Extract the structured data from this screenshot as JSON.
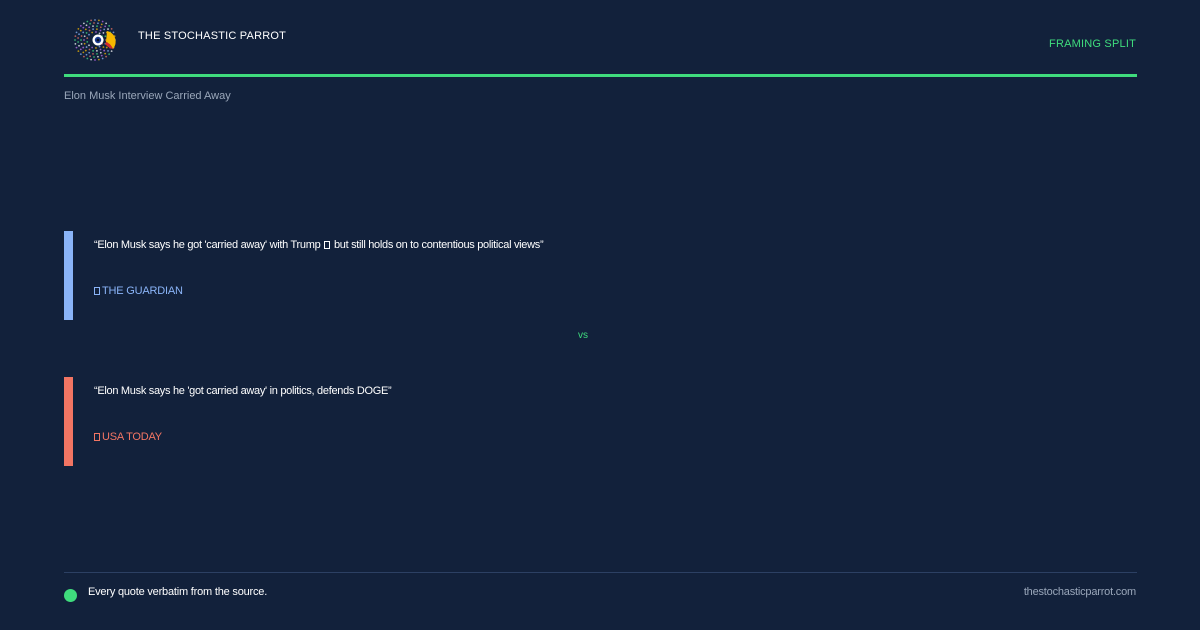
{
  "header": {
    "brand_name": "THE STOCHASTIC PARROT",
    "mode_label": "FRAMING SPLIT",
    "logo_icon": "parrot-logo-icon"
  },
  "story": {
    "title": "Elon Musk Interview Carried Away"
  },
  "quotes": [
    {
      "text_part1": "“Elon Musk says he got 'carried away' with Trump",
      "text_part2": "but still holds on to contentious political views”",
      "source": "THE GUARDIAN",
      "color": "#8ab4f8"
    },
    {
      "text": "“Elon Musk says he 'got carried away' in politics, defends DOGE”",
      "source": "USA TODAY",
      "color": "#f27563"
    }
  ],
  "divider": {
    "label": "vs"
  },
  "footer": {
    "note": "Every quote verbatim from the source.",
    "site": "thestochasticparrot.com"
  },
  "colors": {
    "background": "#12213b",
    "accent": "#3fdc7d",
    "source_1": "#8ab4f8",
    "source_2": "#f27563"
  }
}
